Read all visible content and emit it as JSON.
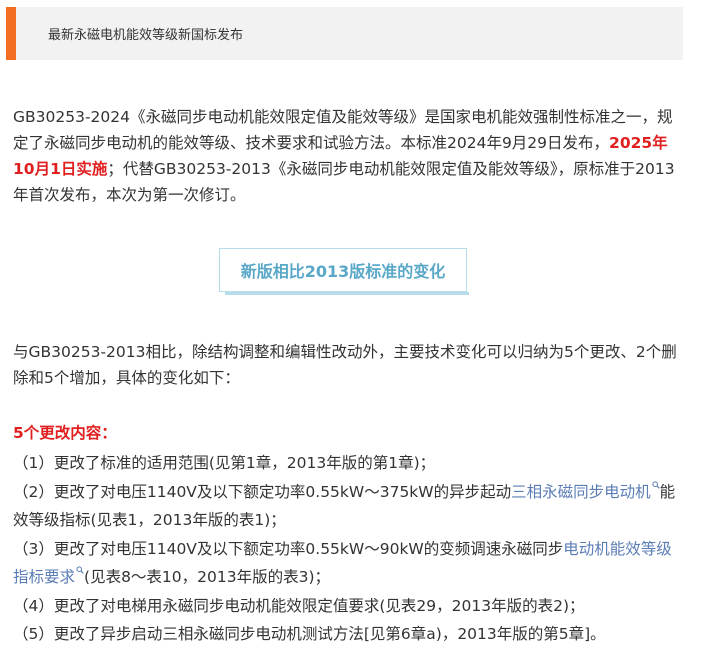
{
  "header": {
    "title": "最新永磁电机能效等级新国标发布",
    "accent_color": "#f36d21"
  },
  "intro": {
    "part1": "GB30253-2024《永磁同步电动机能效限定值及能效等级》是国家电机能效强制性标准之一，规定了永磁同步电动机的能效等级、技术要求和试验方法。本标准2024年9月29日发布，",
    "highlight": "2025年10月1日实施",
    "part2": "；代替GB30253-2013《永磁同步电动机能效限定值及能效等级》，原标准于2013年首次发布，本次为第一次修订。"
  },
  "section": {
    "title": "新版相比2013版标准的变化"
  },
  "summary": {
    "text": "与GB30253-2013相比，除结构调整和编辑性改动外，主要技术变化可以归纳为5个更改、2个删除和5个增加，具体的变化如下："
  },
  "changes": {
    "heading": "5个更改内容：",
    "items": [
      {
        "text": "（1）更改了标准的适用范围(见第1章，2013年版的第1章)；"
      },
      {
        "before": "（2）更改了对电压1140V及以下额定功率0.55kW～375kW的异步起动",
        "link": "三相永磁同步电动机",
        "after": "能效等级指标(见表1，2013年版的表1)；"
      },
      {
        "before": "（3）更改了对电压1140V及以下额定功率0.55kW～90kW的变频调速永磁同步",
        "link": "电动机能效等级指标要求",
        "after": "(见表8～表10，2013年版的表3)；"
      },
      {
        "text": "（4）更改了对电梯用永磁同步电动机能效限定值要求(见表29，2013年版的表2)；"
      },
      {
        "text": "（5）更改了异步启动三相永磁同步电动机测试方法[见第6章a)，2013年版的第5章]。"
      }
    ]
  },
  "colors": {
    "highlight_red": "#e02020",
    "link_blue": "#5b7db5",
    "section_teal": "#5aa8c8"
  }
}
